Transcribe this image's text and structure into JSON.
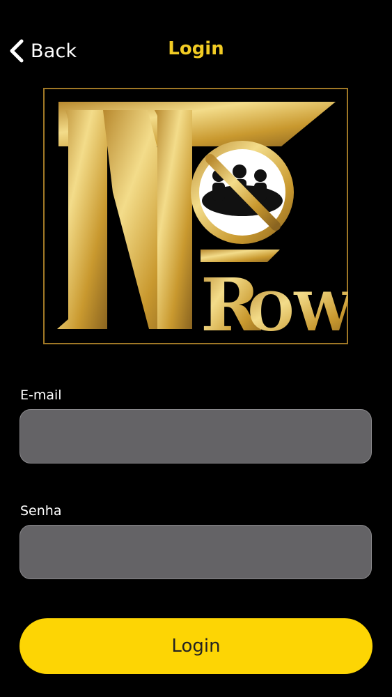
{
  "nav": {
    "back_label": "Back",
    "title": "Login"
  },
  "logo": {
    "wordmark": "NoRow"
  },
  "form": {
    "email": {
      "label": "E-mail",
      "value": "",
      "placeholder": ""
    },
    "password": {
      "label": "Senha",
      "value": "",
      "placeholder": ""
    },
    "submit_label": "Login"
  },
  "colors": {
    "background": "#000000",
    "title_accent": "#f2cc24",
    "input_fill": "#646366",
    "button_fill": "#fdd504",
    "button_text": "#222222",
    "logo_gold": "#d4a843"
  },
  "icons": {
    "back": "chevron-left-icon",
    "logo_emblem": "no-people-sign-icon"
  }
}
